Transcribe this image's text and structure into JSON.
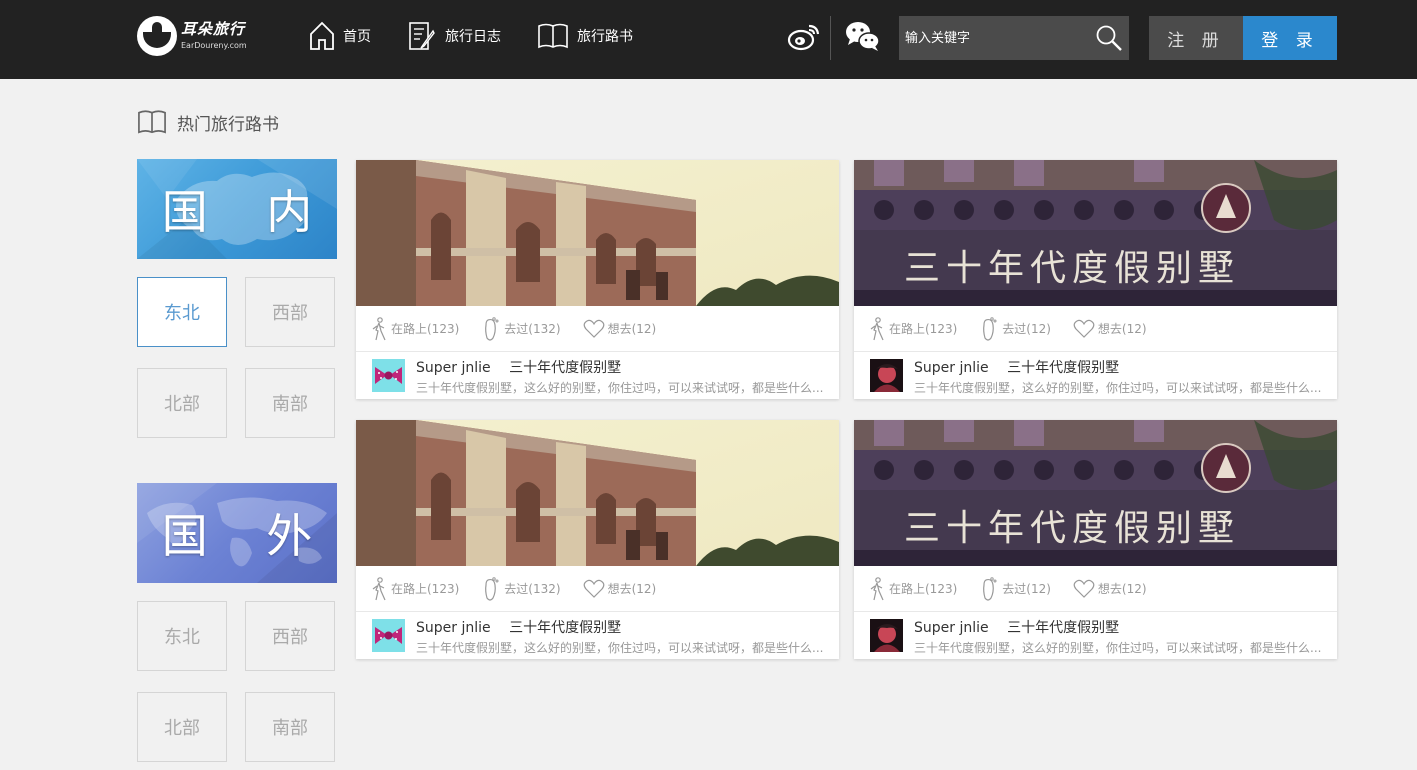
{
  "brand": {
    "name_cn": "耳朵旅行",
    "name_en": "EarDoureny.com"
  },
  "nav": [
    {
      "label": "首页",
      "icon": "home-icon"
    },
    {
      "label": "旅行日志",
      "icon": "diary-icon"
    },
    {
      "label": "旅行路书",
      "icon": "book-icon"
    }
  ],
  "social": {
    "weibo_icon": "weibo-icon",
    "wechat_icon": "wechat-icon"
  },
  "search": {
    "placeholder": "输入关键字",
    "icon": "search-icon"
  },
  "auth": {
    "register_label": "注 册",
    "login_label": "登 录"
  },
  "colors": {
    "header_bg": "#222222",
    "accent": "#2b88cd",
    "page_bg": "#f1f1f1"
  },
  "section": {
    "title": "热门旅行路书",
    "icon": "book-icon"
  },
  "regions": {
    "domestic": {
      "label": "国 内",
      "areas": [
        "东北",
        "西部",
        "北部",
        "南部"
      ],
      "active": "东北"
    },
    "foreign": {
      "label": "国 外",
      "areas": [
        "东北",
        "西部",
        "北部",
        "南部"
      ]
    }
  },
  "cards": [
    {
      "image": "colonial-villa-photo",
      "stats": {
        "on_road": "在路上(123)",
        "visited": "去过(132)",
        "want": "想去(12)"
      },
      "author": "Super jnlie",
      "title": "三十年代度假别墅",
      "desc": "三十年代度假别墅，这么好的别墅，你住过吗，可以来试试呀，都是些什么..."
    },
    {
      "image": "villa-sign-photo",
      "stats": {
        "on_road": "在路上(123)",
        "visited": "去过(12)",
        "want": "想去(12)"
      },
      "author": "Super jnlie",
      "title": "三十年代度假别墅",
      "desc": "三十年代度假别墅，这么好的别墅，你住过吗，可以来试试呀，都是些什么..."
    },
    {
      "image": "colonial-villa-photo",
      "stats": {
        "on_road": "在路上(123)",
        "visited": "去过(132)",
        "want": "想去(12)"
      },
      "author": "Super jnlie",
      "title": "三十年代度假别墅",
      "desc": "三十年代度假别墅，这么好的别墅，你住过吗，可以来试试呀，都是些什么..."
    },
    {
      "image": "villa-sign-photo",
      "stats": {
        "on_road": "在路上(123)",
        "visited": "去过(12)",
        "want": "想去(12)"
      },
      "author": "Super jnlie",
      "title": "三十年代度假别墅",
      "desc": "三十年代度假别墅，这么好的别墅，你住过吗，可以来试试呀，都是些什么..."
    }
  ],
  "sign_text": "三十年代度假别墅"
}
